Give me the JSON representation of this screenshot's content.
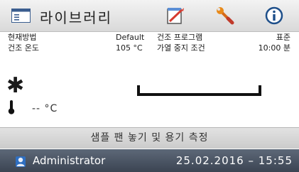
{
  "header": {
    "title": "라이브러리",
    "icons": [
      "library-icon",
      "edit-icon",
      "tools-icon",
      "info-icon"
    ]
  },
  "info": {
    "row1": {
      "label1": "현재방법",
      "value1": "Default",
      "label2": "건조 프로그램",
      "value2": "표준"
    },
    "row2": {
      "label1": "건조 온도",
      "value1": "105 °C",
      "label2": "가열 중지 조건",
      "value2": "10:00 분"
    }
  },
  "readout": {
    "temperature": "-- °C"
  },
  "status": {
    "message": "샘플 팬 놓기 및 용기 측정"
  },
  "footer": {
    "user": "Administrator",
    "datetime": "25.02.2016 – 15:55"
  },
  "colors": {
    "footer": "#4a5463",
    "header": "#e5e5e5",
    "accent_orange": "#e88a1a",
    "accent_red": "#d63a2f",
    "info_blue": "#1e4f8a"
  }
}
